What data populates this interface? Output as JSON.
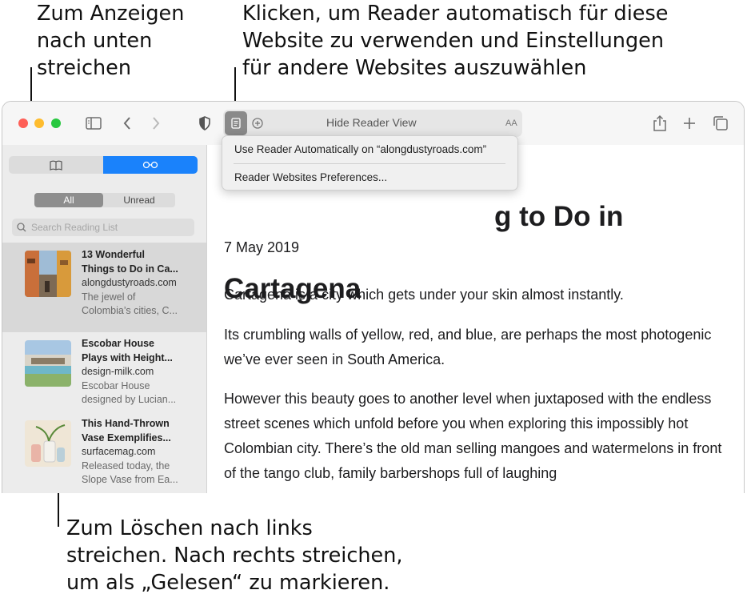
{
  "callouts": {
    "swipe_down": "Zum Anzeigen\nnach unten\nstreichen",
    "reader_click": "Klicken, um Reader automatisch für diese\nWebsite zu verwenden und Einstellungen\nfür andere Websites auszuwählen",
    "swipe_delete": "Zum Löschen nach links\nstreichen. Nach rechts streichen,\num als „Gelesen“ zu markieren."
  },
  "toolbar": {
    "address_title": "Hide Reader View",
    "text_size_label": "AA"
  },
  "reader_menu": {
    "items": [
      "Use Reader Automatically on “alongdustyroads.com”",
      "Reader Websites Preferences..."
    ]
  },
  "sidebar": {
    "filter_all": "All",
    "filter_unread": "Unread",
    "search_placeholder": "Search Reading List",
    "items": [
      {
        "title": "13 Wonderful\nThings to Do in Ca...",
        "site": "alongdustyroads.com",
        "desc": "The jewel of\nColombia’s cities, C..."
      },
      {
        "title": "Escobar House\nPlays with Height...",
        "site": "design-milk.com",
        "desc": "Escobar House\ndesigned by Lucian..."
      },
      {
        "title": "This Hand-Thrown\nVase Exemplifies...",
        "site": "surfacemag.com",
        "desc": "Released today, the\nSlope Vase from Ea..."
      }
    ]
  },
  "article": {
    "title_visible": "g to Do in\nCartagena",
    "date": "7 May 2019",
    "paragraphs": [
      "Cartagena is a city which gets under your skin almost instantly.",
      "Its crumbling walls of yellow, red, and blue, are perhaps the most photogenic we’ve ever seen in South America.",
      "However this beauty goes to another level when juxtaposed with the endless street scenes which unfold before you when exploring this impossibly hot Colombian city. There’s the old man selling mangoes and watermelons in front of the tango club, family barbershops full of laughing"
    ]
  },
  "colors": {
    "accent": "#1a82fb",
    "traffic_red": "#fe5f57",
    "traffic_yellow": "#febc2e",
    "traffic_green": "#28c840"
  }
}
